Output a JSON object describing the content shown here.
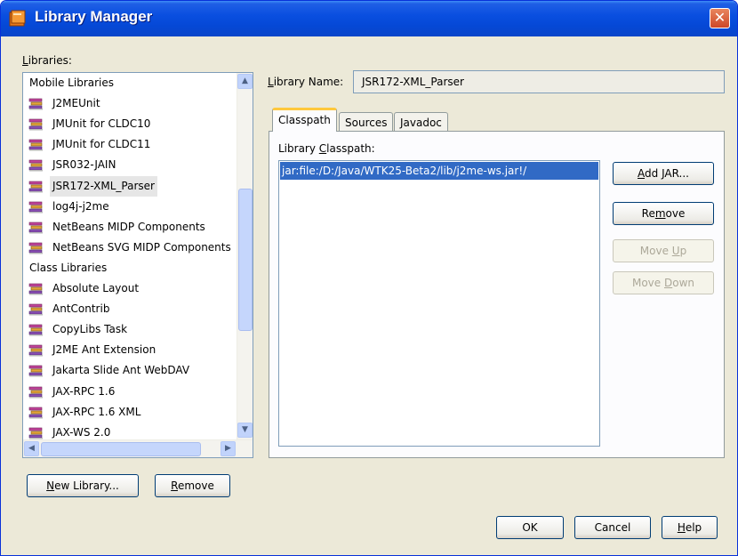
{
  "window": {
    "title": "Library Manager",
    "close_glyph": "✕",
    "title_icon": "folder-books-icon"
  },
  "libraries": {
    "label": "Libraries:",
    "items": [
      {
        "text": "Mobile Libraries",
        "kind": "group"
      },
      {
        "text": "J2MEUnit",
        "kind": "lib"
      },
      {
        "text": "JMUnit for CLDC10",
        "kind": "lib"
      },
      {
        "text": "JMUnit for CLDC11",
        "kind": "lib"
      },
      {
        "text": "JSR032-JAIN",
        "kind": "lib"
      },
      {
        "text": "JSR172-XML_Parser",
        "kind": "lib",
        "selected": true
      },
      {
        "text": "log4j-j2me",
        "kind": "lib"
      },
      {
        "text": "NetBeans MIDP Components",
        "kind": "lib"
      },
      {
        "text": "NetBeans SVG MIDP Components",
        "kind": "lib"
      },
      {
        "text": "Class Libraries",
        "kind": "group"
      },
      {
        "text": "Absolute Layout",
        "kind": "lib"
      },
      {
        "text": "AntContrib",
        "kind": "lib"
      },
      {
        "text": "CopyLibs Task",
        "kind": "lib"
      },
      {
        "text": "J2ME Ant Extension",
        "kind": "lib"
      },
      {
        "text": "Jakarta Slide Ant WebDAV",
        "kind": "lib"
      },
      {
        "text": "JAX-RPC 1.6",
        "kind": "lib"
      },
      {
        "text": "JAX-RPC 1.6 XML",
        "kind": "lib"
      },
      {
        "text": "JAX-WS 2.0",
        "kind": "lib"
      }
    ],
    "scroll": {
      "up": "▲",
      "down": "▼",
      "left": "◀",
      "right": "▶"
    }
  },
  "left_buttons": {
    "new_library": "New Library...",
    "remove": "Remove"
  },
  "library_name": {
    "label": "Library Name:",
    "value": "JSR172-XML_Parser"
  },
  "tabs": [
    {
      "label": "Classpath",
      "active": true
    },
    {
      "label": "Sources",
      "active": false
    },
    {
      "label": "Javadoc",
      "active": false
    }
  ],
  "classpath": {
    "label": "Library Classpath:",
    "entries": [
      "jar:file:/D:/Java/WTK25-Beta2/lib/j2me-ws.jar!/"
    ]
  },
  "right_buttons": {
    "add_jar": "Add JAR...",
    "remove": "Remove",
    "move_up": "Move Up",
    "move_down": "Move Down"
  },
  "footer": {
    "ok": "OK",
    "cancel": "Cancel",
    "help": "Help"
  },
  "colors": {
    "titlebar": "#0A4FE0",
    "selection": "#316AC5",
    "dialog_bg": "#ECE9D8"
  }
}
